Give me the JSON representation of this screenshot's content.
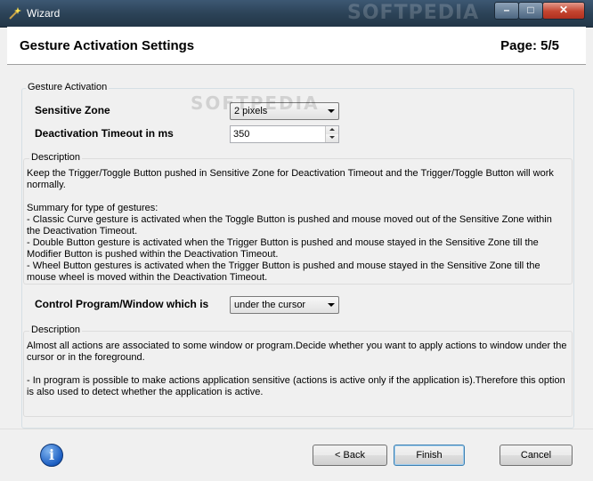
{
  "window": {
    "title": "Wizard",
    "watermark": "SOFTPEDIA",
    "minimize_glyph": "–",
    "maximize_glyph": "□",
    "close_glyph": "✕"
  },
  "header": {
    "title": "Gesture Activation Settings",
    "page": "Page: 5/5"
  },
  "watermark": "SOFTPEDIA",
  "gesture_activation": {
    "legend": "Gesture Activation",
    "sensitive_zone_label": "Sensitive Zone",
    "sensitive_zone_value": "2 pixels",
    "deactivation_timeout_label": "Deactivation Timeout in ms",
    "deactivation_timeout_value": "350"
  },
  "description1": {
    "legend": "Description",
    "text": "Keep the Trigger/Toggle Button pushed in Sensitive Zone for Deactivation Timeout and the Trigger/Toggle Button will work normally.\n\nSummary for type of gestures:\n- Classic Curve gesture is activated when the Toggle Button is pushed and mouse moved out of the Sensitive Zone within the Deactivation Timeout.\n- Double Button gesture is activated when the Trigger Button is pushed and mouse stayed in the Sensitive Zone till the Modifier Button is pushed within the Deactivation Timeout.\n- Wheel Button gestures is activated when the Trigger Button is pushed and mouse stayed in the Sensitive Zone till the mouse wheel is moved within the Deactivation Timeout."
  },
  "control": {
    "label": "Control Program/Window which is",
    "value": "under the cursor"
  },
  "description2": {
    "legend": "Description",
    "text": "Almost all actions are associated to some window or program.Decide whether you want to apply actions to window under the cursor or in the foreground.\n\n- In program is possible to make actions application sensitive (actions is active only if the application is).Therefore this option is also used to detect whether the application is active."
  },
  "footer": {
    "info_glyph": "i",
    "back_label": "< Back",
    "finish_label": "Finish",
    "cancel_label": "Cancel"
  }
}
